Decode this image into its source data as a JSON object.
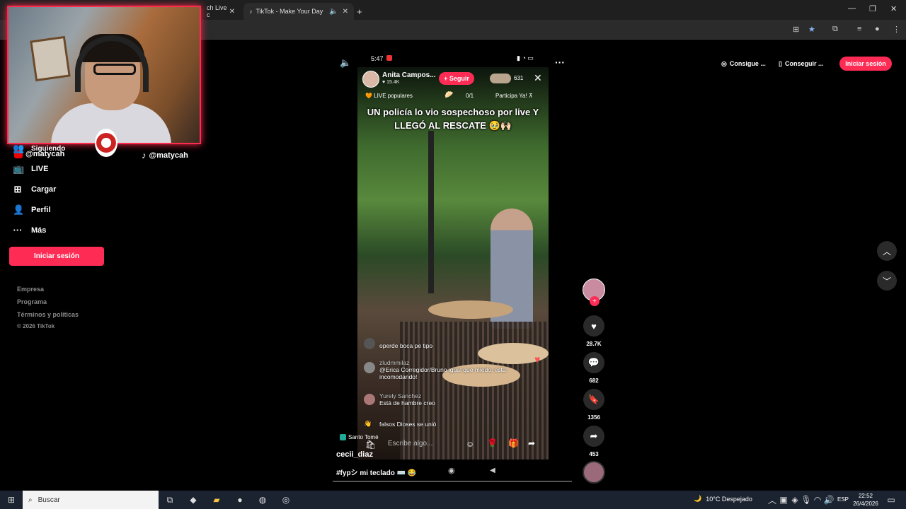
{
  "browser": {
    "tabs": [
      {
        "label": "ch Live c",
        "active": false
      },
      {
        "label": "TikTok - Make Your Day",
        "active": true
      }
    ],
    "new_tab": "+",
    "window_controls": [
      "—",
      "❐",
      "✕"
    ]
  },
  "webcam": {
    "social_youtube": "@matycah",
    "social_tiktok": "@matycah"
  },
  "sidebar": {
    "items": [
      {
        "label": "Siguiendo",
        "icon": "following-icon"
      },
      {
        "label": "LIVE",
        "icon": "live-icon"
      },
      {
        "label": "Cargar",
        "icon": "upload-icon"
      },
      {
        "label": "Perfil",
        "icon": "profile-icon"
      },
      {
        "label": "Más",
        "icon": "more-icon"
      }
    ],
    "login_label": "Iniciar sesión",
    "footer": [
      "Empresa",
      "Programa",
      "Términos y políticas"
    ],
    "copyright": "© 2026 TikTok"
  },
  "topbar": {
    "coins_label": "Consigue ...",
    "app_label": "Conseguir ...",
    "login_label": "Iniciar sesión"
  },
  "phone_status": {
    "time": "5:47"
  },
  "live": {
    "host_name": "Anita Campos...",
    "host_likes": "♥ 15.4K",
    "follow_label": "+ Seguir",
    "viewers": "631",
    "popular_label": "LIVE populares",
    "popular_count": "0/1",
    "participa_label": "Participa Ya!",
    "caption_line1": "UN policía lo vio sospechoso por live Y",
    "caption_line2": "LLEGÓ AL RESCATE 🥹🙌🏻",
    "chat": [
      {
        "user": "",
        "msg": "operde boca pe tipo"
      },
      {
        "user": "zludmmilaz",
        "msg": "@Erica Corregidor/Bruno igual que miedo, esta incomodando!"
      },
      {
        "user": "Yurely Sanchez",
        "msg": "Está de hambre creo"
      },
      {
        "user": "",
        "msg": "falsos Dioses se unió"
      }
    ],
    "location": "Santo Tomé",
    "comment_placeholder": "Escribe algo..."
  },
  "video": {
    "author": "cecii_diaz",
    "hashtags": "#fypシ mi teclado ⌨️ 😂",
    "progress": 0
  },
  "actions": {
    "likes": "28.7K",
    "comments": "682",
    "saves": "1356",
    "shares": "453"
  },
  "taskbar": {
    "search_placeholder": "Buscar",
    "weather": "10°C  Despejado",
    "lang": "ESP",
    "time": "22:52",
    "date": "26/4/2026"
  }
}
